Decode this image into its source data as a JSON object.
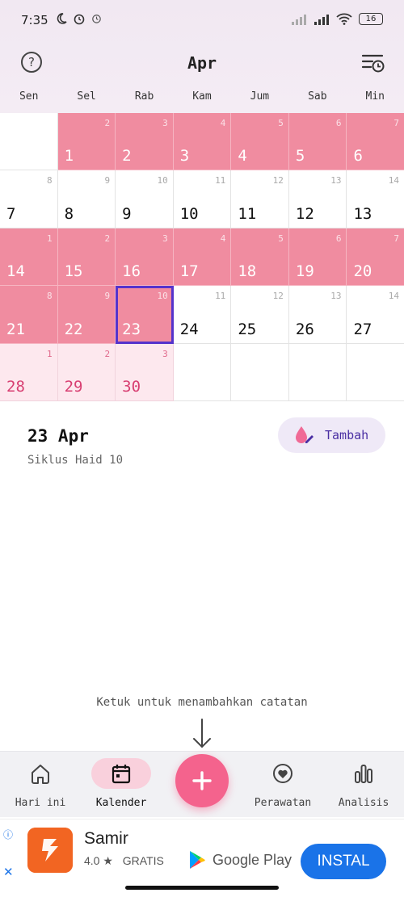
{
  "status_bar": {
    "time": "7:35",
    "battery": "16"
  },
  "header": {
    "month": "Apr"
  },
  "weekdays": [
    "Sen",
    "Sel",
    "Rab",
    "Kam",
    "Jum",
    "Sab",
    "Min"
  ],
  "calendar": {
    "rows": [
      [
        {
          "date": "",
          "cycle": "",
          "type": "blank"
        },
        {
          "date": "1",
          "cycle": "2",
          "type": "period"
        },
        {
          "date": "2",
          "cycle": "3",
          "type": "period"
        },
        {
          "date": "3",
          "cycle": "4",
          "type": "period"
        },
        {
          "date": "4",
          "cycle": "5",
          "type": "period"
        },
        {
          "date": "5",
          "cycle": "6",
          "type": "period"
        },
        {
          "date": "6",
          "cycle": "7",
          "type": "period"
        }
      ],
      [
        {
          "date": "7",
          "cycle": "8",
          "type": "normal"
        },
        {
          "date": "8",
          "cycle": "9",
          "type": "normal"
        },
        {
          "date": "9",
          "cycle": "10",
          "type": "normal"
        },
        {
          "date": "10",
          "cycle": "11",
          "type": "normal"
        },
        {
          "date": "11",
          "cycle": "12",
          "type": "normal"
        },
        {
          "date": "12",
          "cycle": "13",
          "type": "normal"
        },
        {
          "date": "13",
          "cycle": "14",
          "type": "normal"
        }
      ],
      [
        {
          "date": "14",
          "cycle": "1",
          "type": "period"
        },
        {
          "date": "15",
          "cycle": "2",
          "type": "period"
        },
        {
          "date": "16",
          "cycle": "3",
          "type": "period"
        },
        {
          "date": "17",
          "cycle": "4",
          "type": "period"
        },
        {
          "date": "18",
          "cycle": "5",
          "type": "period"
        },
        {
          "date": "19",
          "cycle": "6",
          "type": "period"
        },
        {
          "date": "20",
          "cycle": "7",
          "type": "period"
        }
      ],
      [
        {
          "date": "21",
          "cycle": "8",
          "type": "period"
        },
        {
          "date": "22",
          "cycle": "9",
          "type": "period"
        },
        {
          "date": "23",
          "cycle": "10",
          "type": "period",
          "selected": true
        },
        {
          "date": "24",
          "cycle": "11",
          "type": "normal"
        },
        {
          "date": "25",
          "cycle": "12",
          "type": "normal"
        },
        {
          "date": "26",
          "cycle": "13",
          "type": "normal"
        },
        {
          "date": "27",
          "cycle": "14",
          "type": "normal"
        }
      ],
      [
        {
          "date": "28",
          "cycle": "1",
          "type": "predicted"
        },
        {
          "date": "29",
          "cycle": "2",
          "type": "predicted"
        },
        {
          "date": "30",
          "cycle": "3",
          "type": "predicted"
        },
        {
          "date": "",
          "cycle": "",
          "type": "blank"
        },
        {
          "date": "",
          "cycle": "",
          "type": "blank"
        },
        {
          "date": "",
          "cycle": "",
          "type": "blank"
        },
        {
          "date": "",
          "cycle": "",
          "type": "blank"
        }
      ]
    ]
  },
  "detail": {
    "date": "23 Apr",
    "subtitle": "Siklus Haid 10",
    "add_label": "Tambah"
  },
  "hint": "Ketuk untuk menambahkan catatan",
  "nav": {
    "items": [
      {
        "label": "Hari ini",
        "icon": "home-icon"
      },
      {
        "label": "Kalender",
        "icon": "calendar-icon",
        "active": true
      },
      {
        "label": "Perawatan",
        "icon": "heart-icon"
      },
      {
        "label": "Analisis",
        "icon": "bar-chart-icon"
      }
    ]
  },
  "ad": {
    "app_name": "Samir",
    "rating": "4.0 ★",
    "price": "GRATIS",
    "store": "Google Play",
    "install_label": "INSTAL"
  },
  "colors": {
    "period": "#f08ca0",
    "predicted": "#fde8ee",
    "accent": "#f4638d",
    "selected_outline": "#5533cc",
    "install": "#1a73e8"
  }
}
